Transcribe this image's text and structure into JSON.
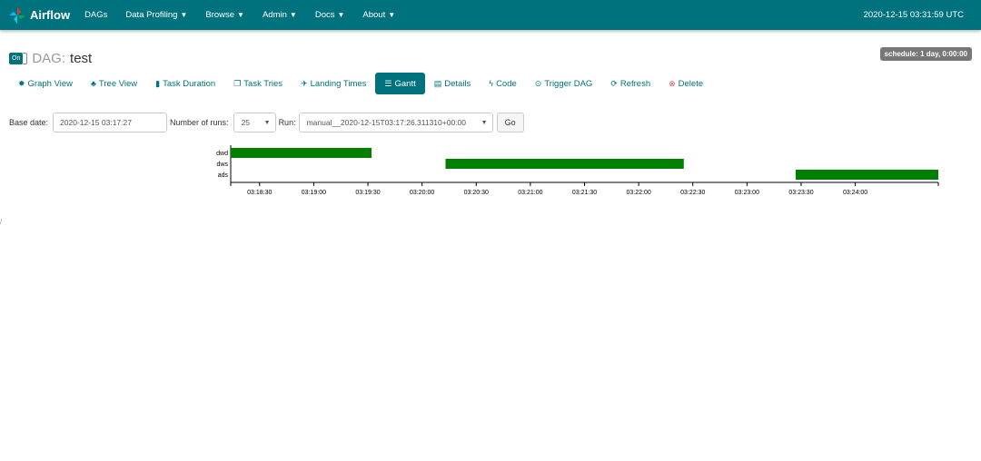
{
  "navbar": {
    "brand": "Airflow",
    "items": [
      {
        "label": "DAGs",
        "dropdown": false
      },
      {
        "label": "Data Profiling",
        "dropdown": true
      },
      {
        "label": "Browse",
        "dropdown": true
      },
      {
        "label": "Admin",
        "dropdown": true
      },
      {
        "label": "Docs",
        "dropdown": true
      },
      {
        "label": "About",
        "dropdown": true
      }
    ],
    "time": "2020-12-15 03:31:59 UTC"
  },
  "dag": {
    "toggle": "On",
    "prefix": "DAG:",
    "name": "test",
    "schedule": "schedule: 1 day, 0:00:00"
  },
  "tabs": [
    {
      "label": "Graph View",
      "icon": "✸"
    },
    {
      "label": "Tree View",
      "icon": "♣"
    },
    {
      "label": "Task Duration",
      "icon": "▮"
    },
    {
      "label": "Task Tries",
      "icon": "❐"
    },
    {
      "label": "Landing Times",
      "icon": "✈"
    },
    {
      "label": "Gantt",
      "icon": "☰",
      "active": true
    },
    {
      "label": "Details",
      "icon": "▤"
    },
    {
      "label": "Code",
      "icon": "ϟ"
    },
    {
      "label": "Trigger DAG",
      "icon": "⊙"
    },
    {
      "label": "Refresh",
      "icon": "⟳"
    },
    {
      "label": "Delete",
      "icon": "⊗"
    }
  ],
  "controls": {
    "base_date_label": "Base date:",
    "base_date_value": "2020-12-15 03:17:27",
    "runs_label": "Number of runs:",
    "runs_value": "25",
    "run_label": "Run:",
    "run_value": "manual__2020-12-15T03:17:26.311310+00:00",
    "go_label": "Go"
  },
  "chart_data": {
    "type": "gantt",
    "tasks": [
      {
        "name": "dwd",
        "start": "03:18:14",
        "end": "03:19:32"
      },
      {
        "name": "dws",
        "start": "03:20:13",
        "end": "03:22:25"
      },
      {
        "name": "ads",
        "start": "03:23:27",
        "end": "03:24:46"
      }
    ],
    "x_ticks": [
      "03:18:30",
      "03:19:00",
      "03:19:30",
      "03:20:00",
      "03:20:30",
      "03:21:00",
      "03:21:30",
      "03:22:00",
      "03:22:30",
      "03:23:00",
      "03:23:30",
      "03:24:00"
    ],
    "xlim": [
      "03:18:14",
      "03:24:46"
    ],
    "bar_color": "#008000"
  },
  "misc": {
    "left_mark": "/"
  }
}
